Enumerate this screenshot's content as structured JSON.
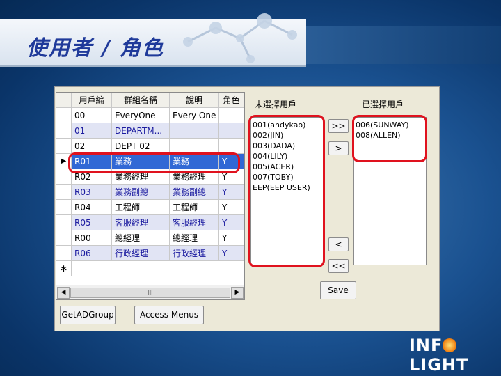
{
  "slide": {
    "title": "使用者 / 角色",
    "logo_text_left": "INF",
    "logo_text_right": "LIGHT"
  },
  "grid": {
    "columns": [
      "用戶編",
      "群組名稱",
      "說明",
      "角色"
    ],
    "rows": [
      {
        "id": "00",
        "name": "EveryOne",
        "desc": "Every One",
        "role": "",
        "style": "normal"
      },
      {
        "id": "01",
        "name": "DEPARTM...",
        "desc": "",
        "role": "",
        "style": "alt"
      },
      {
        "id": "02",
        "name": "DEPT 02",
        "desc": "",
        "role": "",
        "style": "normal"
      },
      {
        "id": "R01",
        "name": "業務",
        "desc": "業務",
        "role": "Y",
        "style": "selected"
      },
      {
        "id": "R02",
        "name": "業務經理",
        "desc": "業務經理",
        "role": "Y",
        "style": "normal"
      },
      {
        "id": "R03",
        "name": "業務副總",
        "desc": "業務副總",
        "role": "Y",
        "style": "alt"
      },
      {
        "id": "R04",
        "name": "工程師",
        "desc": "工程師",
        "role": "Y",
        "style": "normal"
      },
      {
        "id": "R05",
        "name": "客服經理",
        "desc": "客服經理",
        "role": "Y",
        "style": "alt"
      },
      {
        "id": "R00",
        "name": "總經理",
        "desc": "總經理",
        "role": "Y",
        "style": "normal"
      },
      {
        "id": "R06",
        "name": "行政經理",
        "desc": "行政經理",
        "role": "Y",
        "style": "alt"
      }
    ],
    "current_row_marker": "▶",
    "new_row_marker": "∗",
    "scroll_left": "◀",
    "scroll_right": "▶",
    "scroll_grip": "III"
  },
  "unselected": {
    "label": "未選擇用戶",
    "items": [
      "001(andykao)",
      "002(JIN)",
      "003(DADA)",
      "004(LILY)",
      "005(ACER)",
      "007(TOBY)",
      "EEP(EEP USER)"
    ]
  },
  "selected": {
    "label": "已選擇用戶",
    "items": [
      "006(SUNWAY)",
      "008(ALLEN)"
    ]
  },
  "buttons": {
    "add_all": ">>",
    "add_one": ">",
    "remove_one": "<",
    "remove_all": "<<",
    "save": "Save",
    "get_ad_group": "GetADGroup",
    "access_menus": "Access Menus"
  },
  "colors": {
    "highlight_box": "#e0121e",
    "selected_row": "#3168d5",
    "alt_row": "#e1e4f4"
  }
}
